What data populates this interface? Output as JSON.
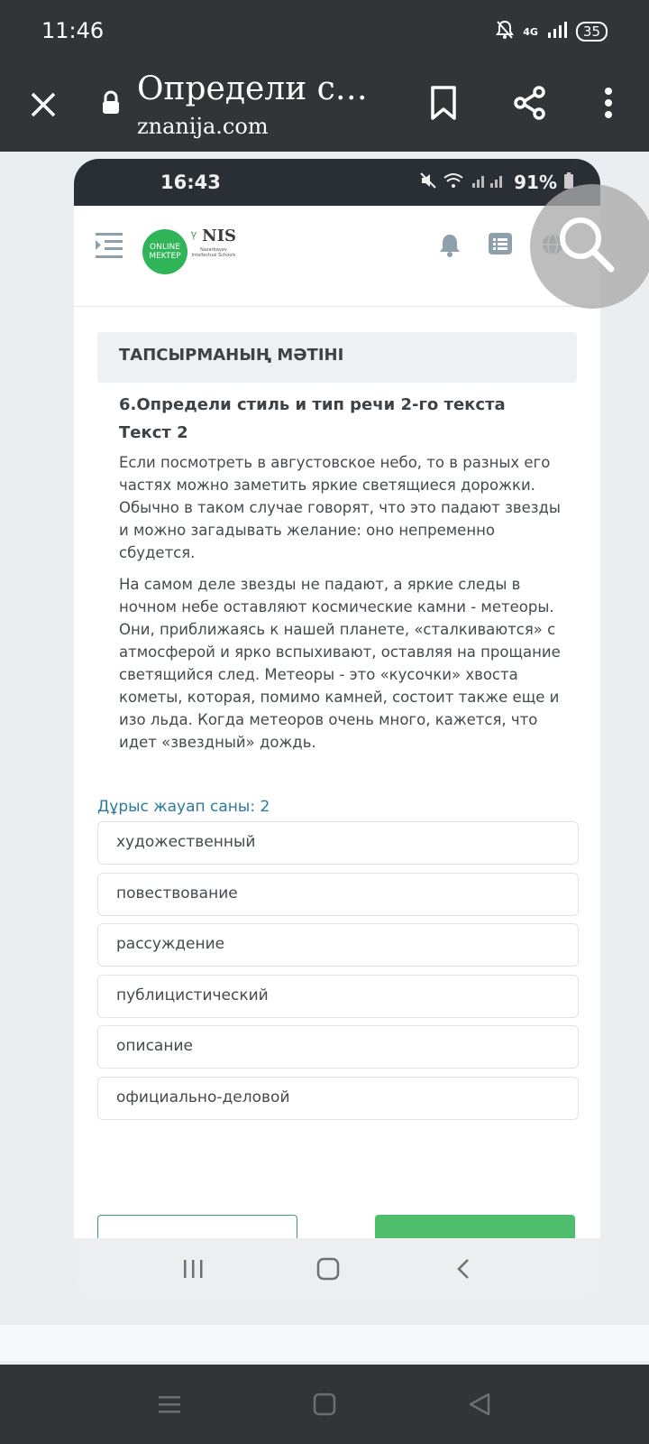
{
  "status_bar": {
    "time": "11:46",
    "network": "4G",
    "battery": "35"
  },
  "browser": {
    "title": "Определи с…",
    "url": "znanija.com"
  },
  "screenshot": {
    "status": {
      "time": "16:43",
      "battery": "91%"
    },
    "logo": {
      "line1": "ONLINE",
      "line2": "MEKTEP",
      "nis": "NIS",
      "nis_sub": "Nazarbayev Intellectual Schools"
    },
    "task_header": "ТАПСЫРМАНЫҢ МӘТІНІ",
    "question": "6.Определи стиль и тип речи 2-го текста",
    "text_title": "Текст 2",
    "paragraphs": [
      "Если посмотреть в августовское небо, то в разных его частях можно заметить яркие светящиеся дорожки. Обычно в таком случае говорят, что это падают звезды и можно загадывать желание: оно непременно сбудется.",
      "На самом деле звезды не падают, а яркие следы в ночном небе оставляют космические камни - метеоры. Они, приближаясь к нашей планете, «сталкиваются» с атмосферой и ярко вспыхивают, оставляя на прощание светящийся след. Метеоры - это «кусочки» хвоста кометы, которая, помимо камней, состоит также еще и изо льда. Когда метеоров очень много, кажется, что идет «звездный» дождь."
    ],
    "answer_count": "Дұрыс жауап саны: 2",
    "options": [
      "художественный",
      "повествование",
      "рассуждение",
      "публицистический",
      "описание",
      "официально-деловой"
    ]
  },
  "colors": {
    "accent_green": "#4fbe6c",
    "link_blue": "#2c7aa0",
    "dark_bar": "#323537"
  },
  "icons": [
    "close-icon",
    "lock-icon",
    "bookmark-icon",
    "share-icon",
    "more-icon",
    "search-icon",
    "bell-icon",
    "list-icon",
    "globe-icon",
    "menu-icon"
  ]
}
